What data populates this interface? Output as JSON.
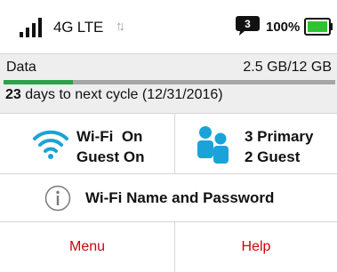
{
  "status": {
    "network": "4G LTE",
    "message_count": "3",
    "battery": "100%",
    "signal_icon": "signal-bars-icon",
    "transfer_icon": "up-down-arrows-icon",
    "message_icon": "message-bubble-icon",
    "battery_icon": "battery-full-icon",
    "accent": "#2aa24a"
  },
  "data_usage": {
    "label": "Data",
    "usage_text": "2.5 GB/12 GB",
    "used_gb": 2.5,
    "total_gb": 12,
    "cycle_days": "23",
    "cycle_rest": " days to next cycle (12/31/2016)",
    "fill_color": "#2aa24a"
  },
  "wifi": {
    "line1": "Wi-Fi  On",
    "line2": "Guest On",
    "icon": "wifi-icon",
    "icon_color": "#1aa3d8"
  },
  "devices": {
    "line1": "3 Primary",
    "line2": "2 Guest",
    "icon": "people-icon",
    "icon_color": "#1aa3d8"
  },
  "wifi_name": {
    "label": "Wi-Fi Name and Password",
    "icon": "info-icon"
  },
  "nav": {
    "menu": "Menu",
    "help": "Help",
    "color": "#cd040b"
  }
}
